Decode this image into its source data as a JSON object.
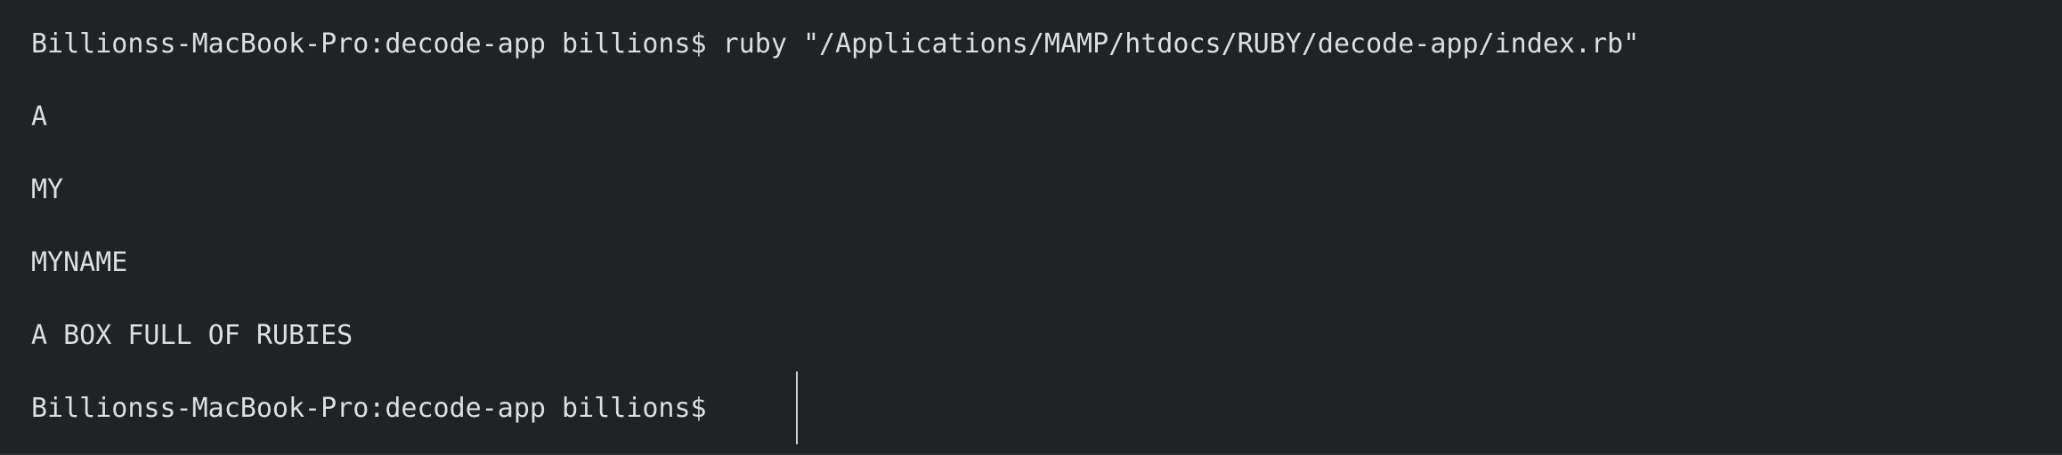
{
  "terminal": {
    "prompt": "Billionss-MacBook-Pro:decode-app billions$",
    "command": "ruby \"/Applications/MAMP/htdocs/RUBY/decode-app/index.rb\"",
    "output": [
      "A",
      "MY",
      "MYNAME",
      "A BOX FULL OF RUBIES"
    ],
    "final_prompt": "Billionss-MacBook-Pro:decode-app billions$"
  }
}
